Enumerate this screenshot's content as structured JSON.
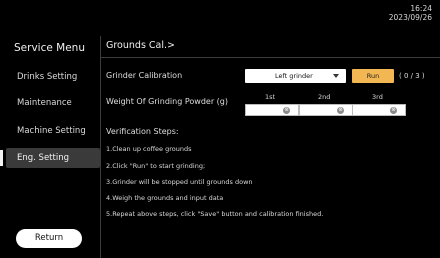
{
  "status": {
    "time": "16:24",
    "date": "2023/09/26"
  },
  "sidebar": {
    "title": "Service Menu",
    "items": [
      {
        "label": "Drinks Setting"
      },
      {
        "label": "Maintenance"
      },
      {
        "label": "Machine Setting"
      },
      {
        "label": "Eng. Setting",
        "active": true
      }
    ],
    "return_label": "Return"
  },
  "main": {
    "breadcrumb": "Grounds Cal.>",
    "grinder_calibration": {
      "label": "Grinder Calibration",
      "selected": "Left grinder",
      "run_label": "Run",
      "counter": "( 0 / 3 )"
    },
    "weight": {
      "label": "Weight Of Grinding Powder (g)",
      "columns": [
        "1st",
        "2nd",
        "3rd"
      ],
      "values": [
        "",
        "",
        ""
      ],
      "clear_icon": "clear-icon"
    },
    "verification": {
      "title": "Verification Steps:",
      "steps": [
        "1.Clean up coffee grounds",
        "2.Click \"Run\" to start grinding;",
        "3.Grinder will be stopped until grounds down",
        "4.Weigh the grounds and input data",
        "5.Repeat above steps, click \"Save\" button and calibration finished."
      ]
    }
  },
  "colors": {
    "background": "#000000",
    "accent": "#f2b652",
    "active_item": "#3a3a3a"
  }
}
